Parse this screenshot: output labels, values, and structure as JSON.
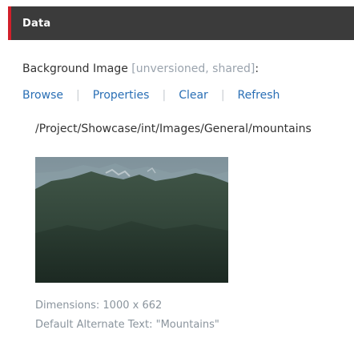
{
  "section": {
    "title": "Data"
  },
  "field": {
    "label": "Background Image",
    "meta": "[unversioned, shared]",
    "suffix": ":"
  },
  "actions": {
    "browse": "Browse",
    "properties": "Properties",
    "clear": "Clear",
    "refresh": "Refresh",
    "separator": "|"
  },
  "image": {
    "path": "/Project/Showcase/int/Images/General/mountains",
    "dimensions_label": "Dimensions:",
    "dimensions_value": "1000 x 662",
    "alt_label": "Default Alternate Text:",
    "alt_value": "\"Mountains\""
  },
  "colors": {
    "header_bg": "#3b3b3b",
    "header_accent": "#d11f2a",
    "link": "#2a6fb5",
    "muted": "#9aa3ad"
  }
}
